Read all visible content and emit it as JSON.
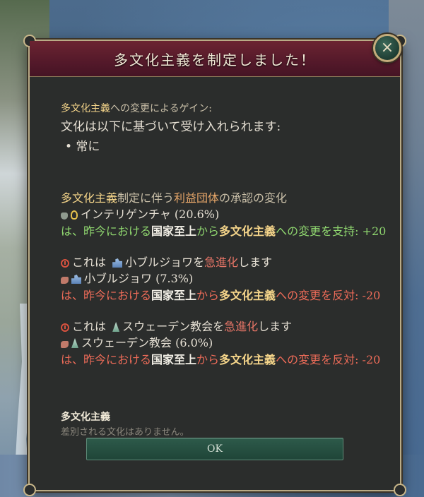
{
  "dialog": {
    "title": "多文化主義を制定しました！",
    "close_symbol": "×",
    "ok_label": "OK"
  },
  "gain": {
    "header_term": "多文化主義",
    "header_rest": "への変更によるゲイン:",
    "line": "文化は以下に基づいて受け入れられます:",
    "bullet": "• 常に"
  },
  "approval": {
    "header_term": "多文化主義",
    "header_mid": "制定に伴う",
    "header_term2": "利益団体",
    "header_rest": "の承認の変化",
    "group1": {
      "name": "インテリゲンチャ (20.6%)",
      "line_prefix": "は、昨今における",
      "from": "国家至上",
      "middle": "から",
      "to": "多文化主義",
      "line_suffix": "への変更を支持: +20"
    },
    "group2": {
      "warn_prefix": "これは",
      "warn_name": "小ブルジョワ",
      "warn_mid": "を",
      "warn_term": "急進化",
      "warn_suffix": "します",
      "name": "小ブルジョワ (7.3%)",
      "line_prefix": "は、昨今における",
      "from": "国家至上",
      "middle": "から",
      "to": "多文化主義",
      "line_suffix": "への変更を反対: -20"
    },
    "group3": {
      "warn_prefix": "これは",
      "warn_name": "スウェーデン教会",
      "warn_mid": "を",
      "warn_term": "急進化",
      "warn_suffix": "します",
      "name": "スウェーデン教会 (6.0%)",
      "line_prefix": "は、昨今における",
      "from": "国家至上",
      "middle": "から",
      "to": "多文化主義",
      "line_suffix": "への変更を反対: -20"
    }
  },
  "footer": {
    "title": "多文化主義",
    "subtitle": "差別される文化はありません。"
  },
  "colors": {
    "header_bg": "#54192a",
    "panel_bg": "#2b2d2c",
    "gold": "#f5d58a",
    "green": "#8fd66f",
    "red": "#ec6b58",
    "button_bg": "#2d5a4a"
  }
}
